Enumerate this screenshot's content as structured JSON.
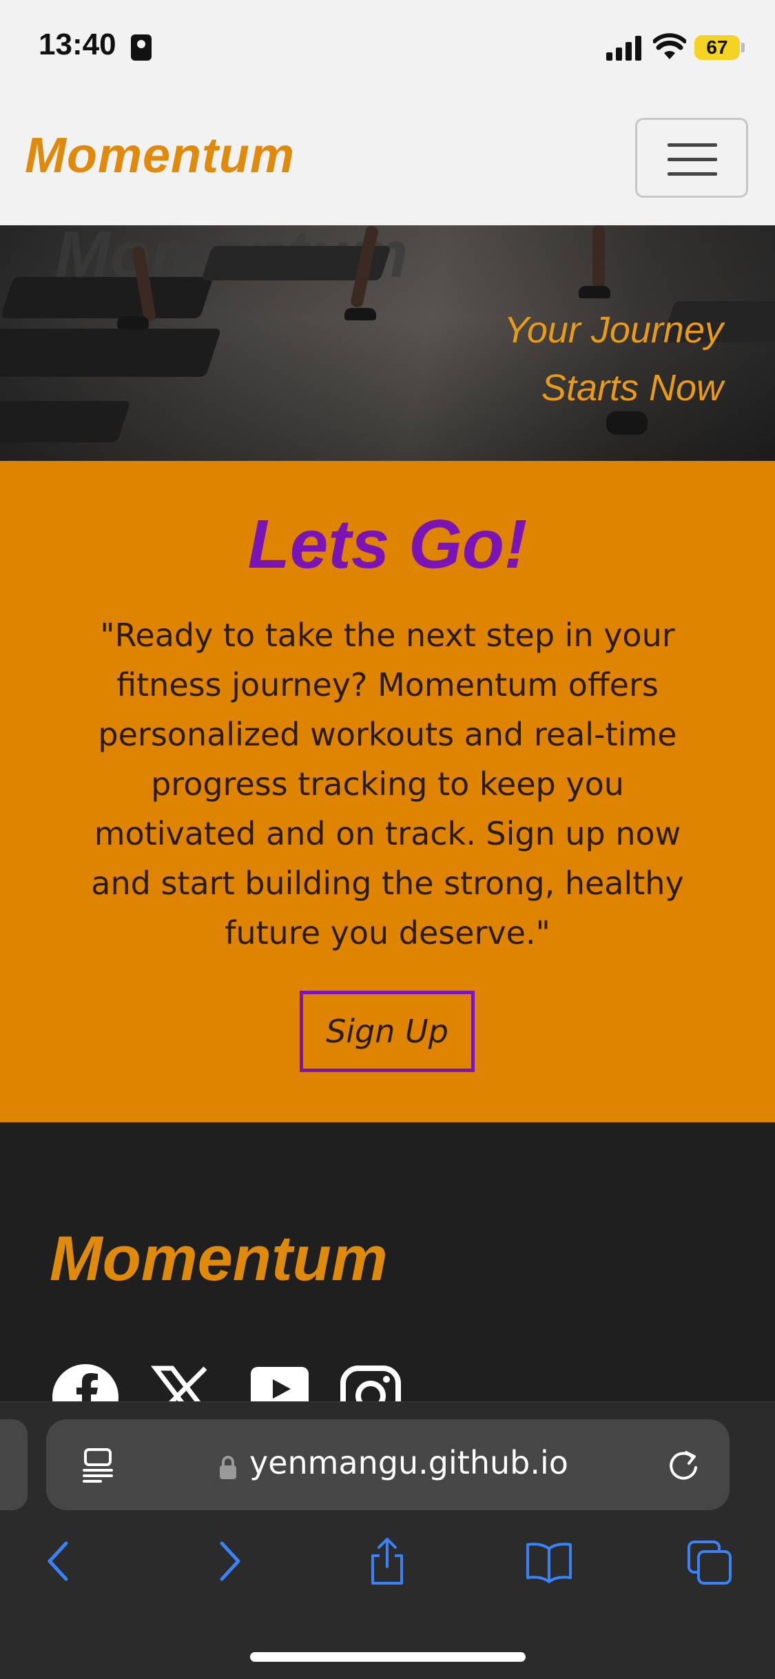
{
  "status_bar": {
    "time": "13:40",
    "battery": "67"
  },
  "navbar": {
    "brand": "Momentum"
  },
  "hero": {
    "background_word": "Momentum",
    "tagline_line1": "Your Journey",
    "tagline_line2": "Starts Now"
  },
  "cta": {
    "title": "Lets Go!",
    "body": "\"Ready to take the next step in your fitness journey? Momentum offers personalized workouts and real-time progress tracking to keep you motivated and on track. Sign up now and start building the strong, healthy future you deserve.\"",
    "button": "Sign Up"
  },
  "footer": {
    "brand": "Momentum",
    "social_icons": [
      "facebook-icon",
      "x-icon",
      "youtube-icon",
      "instagram-icon"
    ]
  },
  "browser": {
    "url": "yenmangu.github.io",
    "toolbar_icons": [
      "back-icon",
      "forward-icon",
      "share-icon",
      "bookmarks-icon",
      "tabs-icon"
    ]
  },
  "colors": {
    "brand_orange": "#e08a0b",
    "cta_background": "#df8400",
    "purple_accent": "#7a14b6",
    "footer_background": "#1f1f1f",
    "safari_blue": "#3b82f6"
  }
}
